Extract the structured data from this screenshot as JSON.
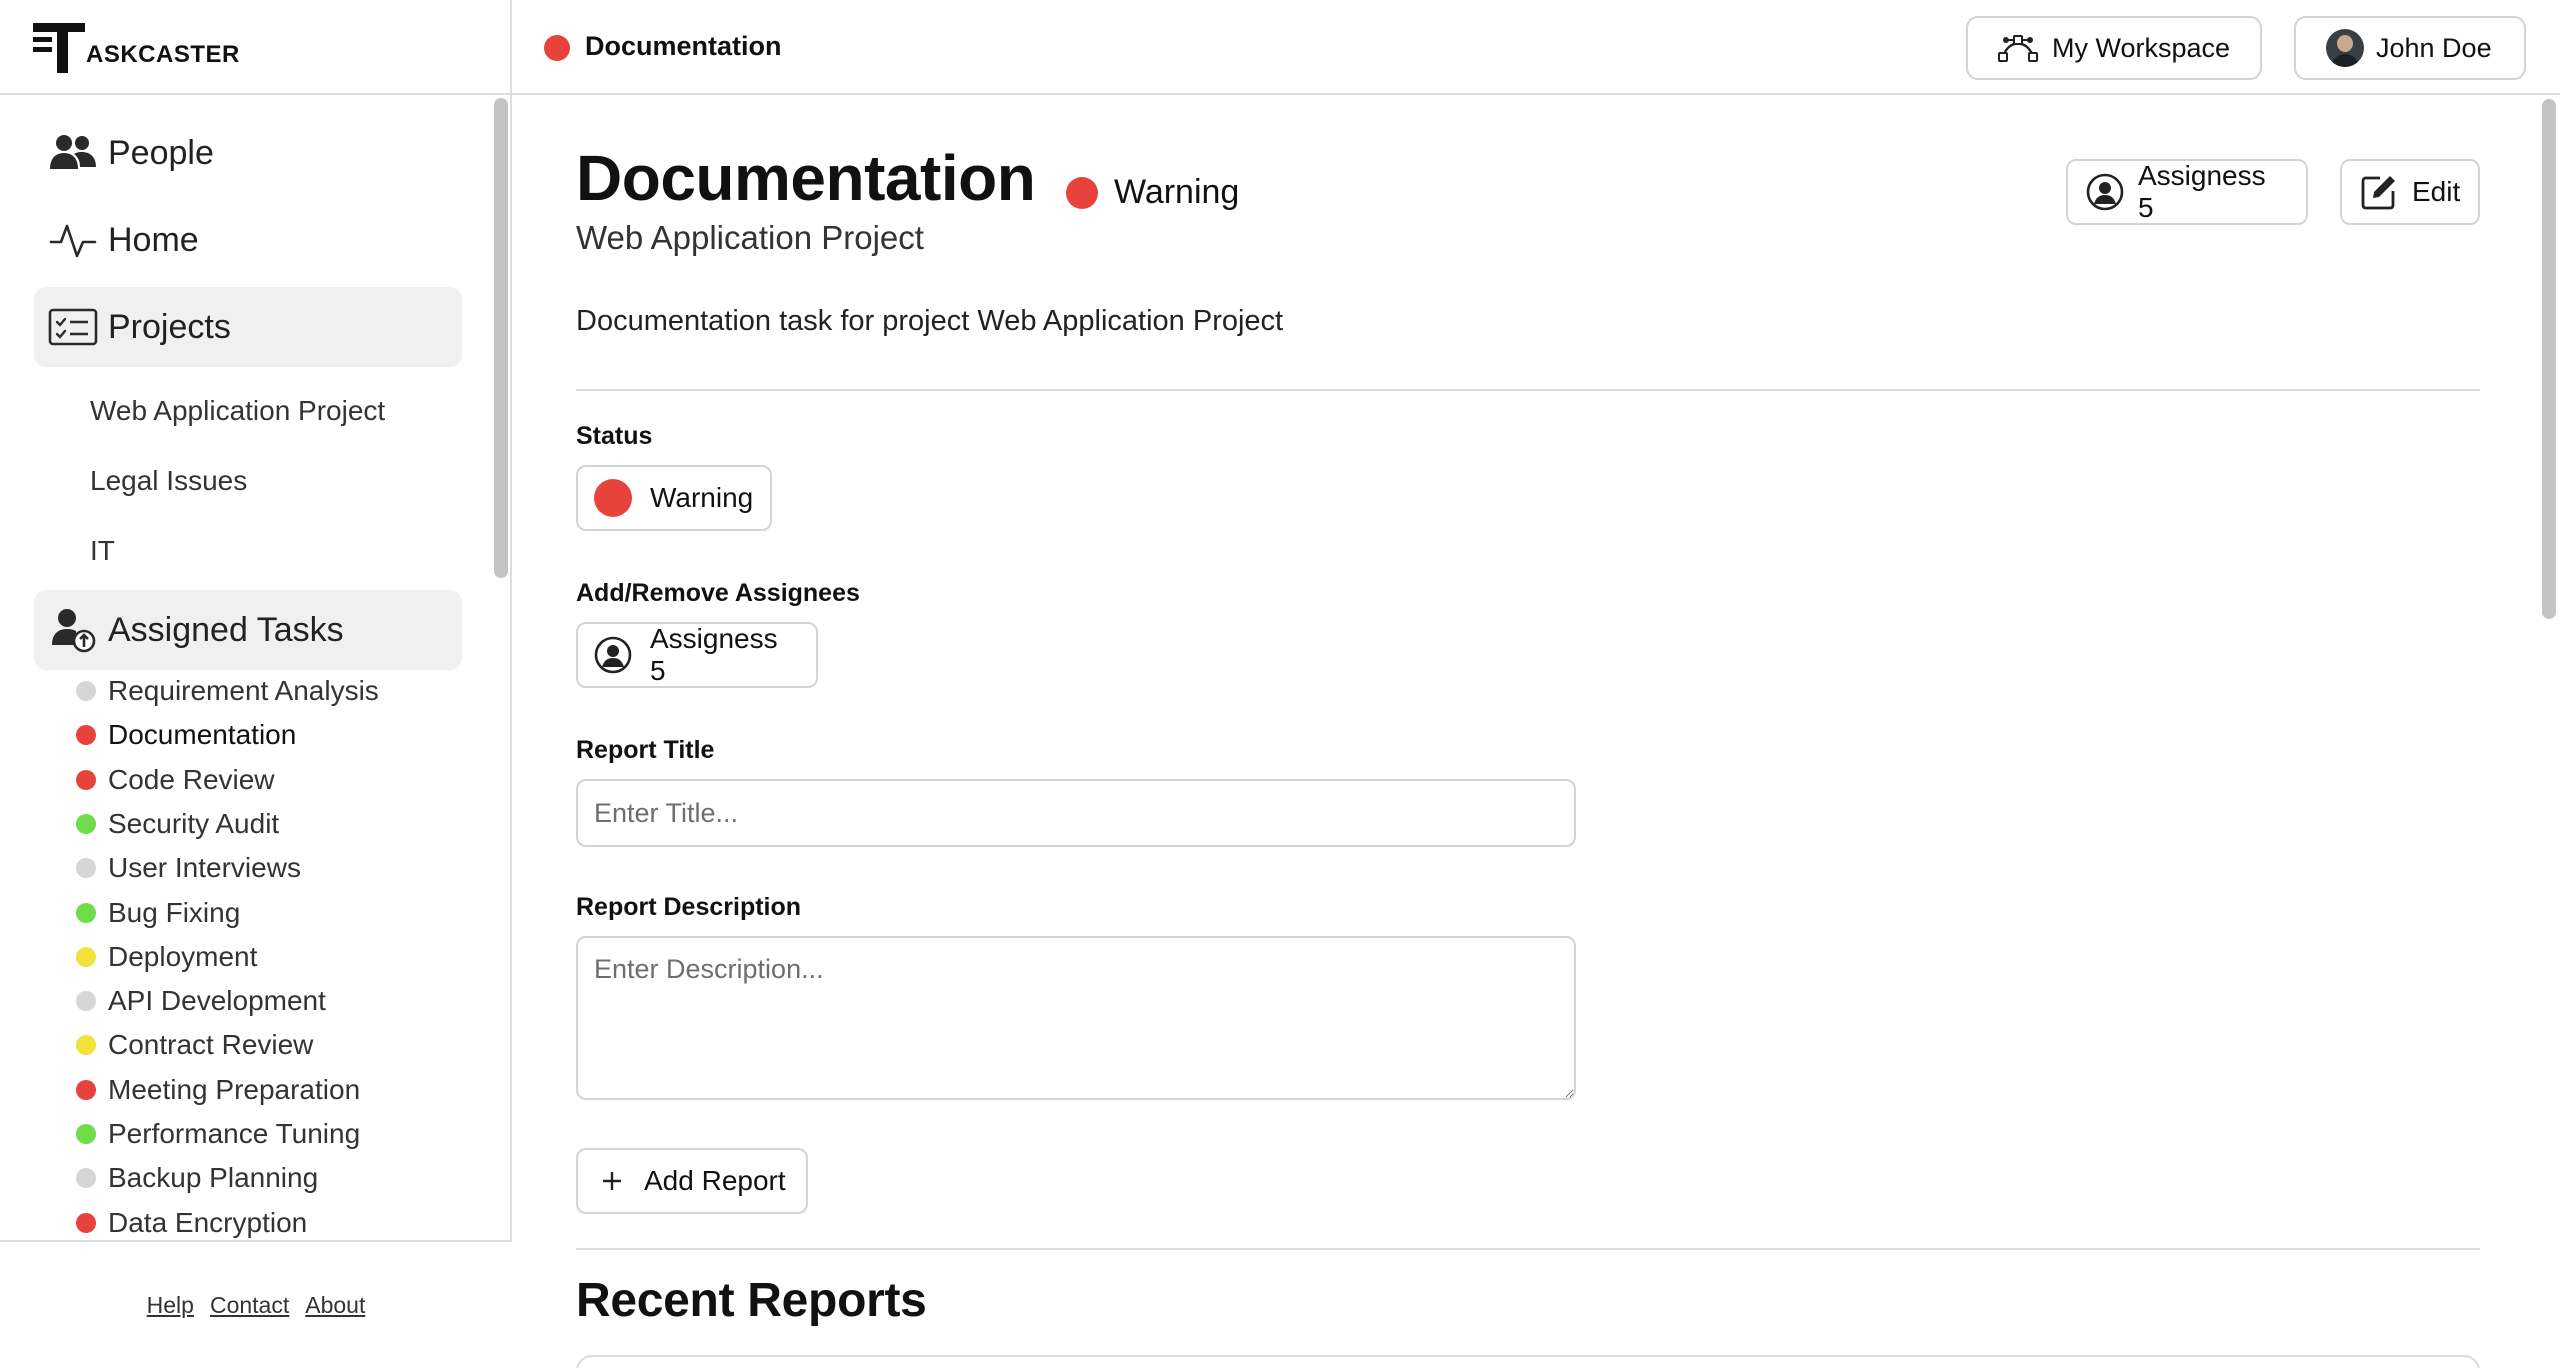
{
  "app": {
    "logo_text": "ASKCASTER"
  },
  "colors": {
    "red": "#e8423c",
    "green": "#6fdc4a",
    "yellow": "#f2e23c",
    "gray": "#d6d6d6"
  },
  "sidebar": {
    "nav": {
      "people": "People",
      "home": "Home",
      "projects": "Projects",
      "assigned_tasks": "Assigned Tasks"
    },
    "projects": [
      "Web Application Project",
      "Legal Issues",
      "IT"
    ],
    "tasks": [
      {
        "label": "Requirement Analysis",
        "status": "gray"
      },
      {
        "label": "Documentation",
        "status": "red"
      },
      {
        "label": "Code Review",
        "status": "red"
      },
      {
        "label": "Security Audit",
        "status": "green"
      },
      {
        "label": "User Interviews",
        "status": "gray"
      },
      {
        "label": "Bug Fixing",
        "status": "green"
      },
      {
        "label": "Deployment",
        "status": "yellow"
      },
      {
        "label": "API Development",
        "status": "gray"
      },
      {
        "label": "Contract Review",
        "status": "yellow"
      },
      {
        "label": "Meeting Preparation",
        "status": "red"
      },
      {
        "label": "Performance Tuning",
        "status": "green"
      },
      {
        "label": "Backup Planning",
        "status": "gray"
      },
      {
        "label": "Data Encryption",
        "status": "red"
      }
    ],
    "footer": {
      "help": "Help",
      "contact": "Contact",
      "about": "About"
    }
  },
  "topbar": {
    "title": "Documentation",
    "workspace_label": "My Workspace",
    "user_name": "John Doe"
  },
  "main": {
    "title": "Documentation",
    "status": "Warning",
    "subtitle": "Web Application Project",
    "description": "Documentation task for project Web Application Project",
    "assignees_button": "Assigness 5",
    "edit_button": "Edit",
    "status_label": "Status",
    "status_value": "Warning",
    "assignees_label": "Add/Remove Assignees",
    "assignees_value": "Assigness 5",
    "report_title_label": "Report Title",
    "report_title_placeholder": "Enter Title...",
    "report_description_label": "Report Description",
    "report_description_placeholder": "Enter Description...",
    "add_report_button": "Add Report",
    "recent_reports_heading": "Recent Reports"
  }
}
